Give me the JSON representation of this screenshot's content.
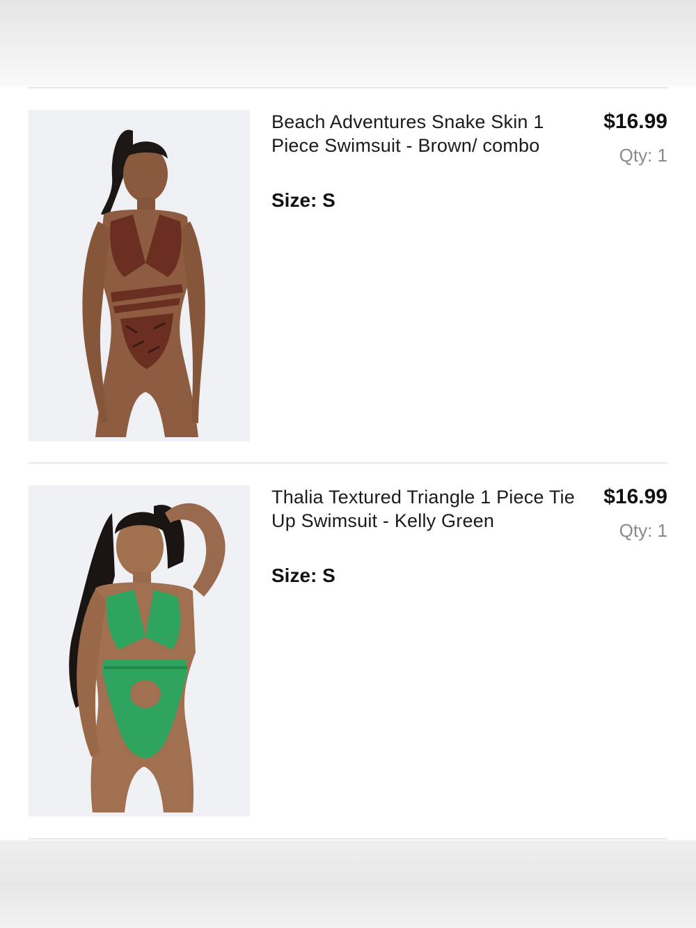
{
  "cart": {
    "items": [
      {
        "name": "Beach Adventures Snake Skin 1 Piece Swimsuit - Brown/ combo",
        "size": "Size: S",
        "price": "$16.99",
        "qty": "Qty: 1",
        "image": "model-brown-snake-skin-swimsuit",
        "swatch": "#7a3a26"
      },
      {
        "name": "Thalia Textured Triangle 1 Piece Tie Up Swimsuit - Kelly Green",
        "size": "Size: S",
        "price": "$16.99",
        "qty": "Qty: 1",
        "image": "model-kelly-green-swimsuit",
        "swatch": "#2fa45f"
      }
    ]
  },
  "colors": {
    "background": "#ffffff",
    "divider": "#e6e6e6",
    "text": "#111111",
    "muted": "#8a8a8a"
  }
}
